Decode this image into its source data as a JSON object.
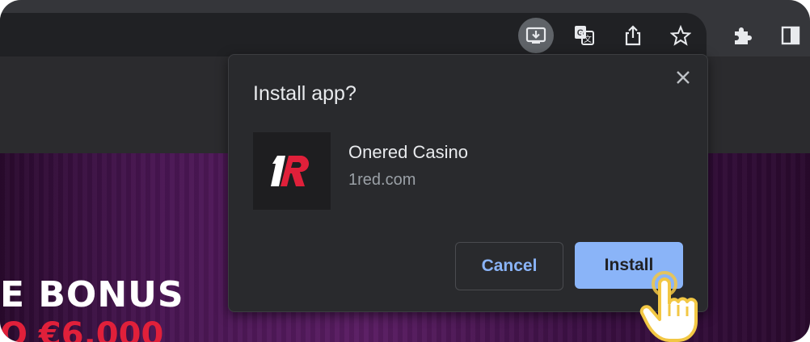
{
  "toolbar": {
    "icons": [
      "install-app-icon",
      "translate-icon",
      "share-icon",
      "bookmark-star-icon",
      "extensions-puzzle-icon",
      "side-panel-icon"
    ]
  },
  "banner": {
    "title": "E BONUS",
    "amount": "O €6,000"
  },
  "dialog": {
    "title": "Install app?",
    "app_name": "Onered Casino",
    "app_domain": "1red.com",
    "logo_text": "1R",
    "cancel_label": "Cancel",
    "install_label": "Install"
  },
  "colors": {
    "accent": "#8ab4f8",
    "logo_red": "#e0203a",
    "pointer_yellow": "#f2c744"
  }
}
